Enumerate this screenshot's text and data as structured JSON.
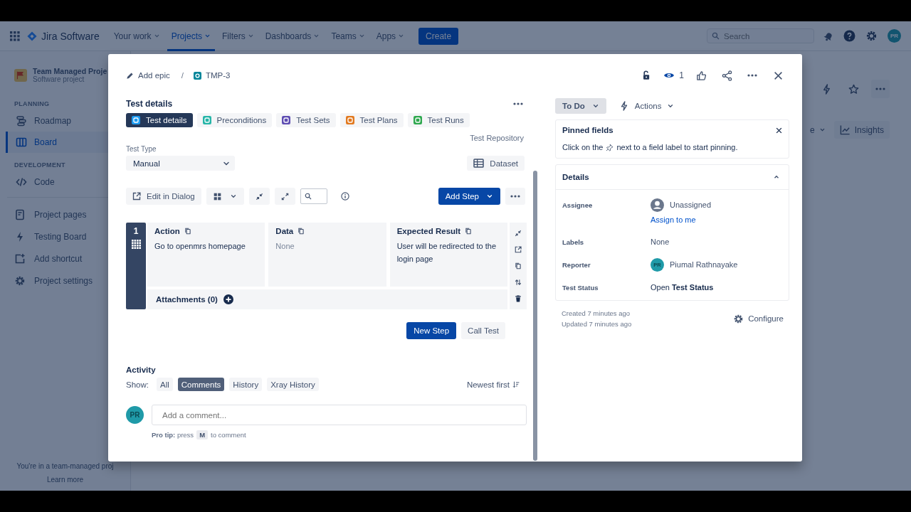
{
  "nav": {
    "product": "Jira Software",
    "items": [
      {
        "label": "Your work",
        "selected": false
      },
      {
        "label": "Projects",
        "selected": true
      },
      {
        "label": "Filters",
        "selected": false
      },
      {
        "label": "Dashboards",
        "selected": false
      },
      {
        "label": "Teams",
        "selected": false
      },
      {
        "label": "Apps",
        "selected": false
      }
    ],
    "create": "Create",
    "search_placeholder": "Search",
    "avatar": "PR"
  },
  "sidebar": {
    "project_name": "Team Managed Proje",
    "project_type": "Software project",
    "sections": [
      {
        "heading": "PLANNING",
        "items": [
          {
            "label": "Roadmap",
            "kind": "roadmap",
            "selected": false
          },
          {
            "label": "Board",
            "kind": "board",
            "selected": true
          }
        ]
      },
      {
        "heading": "DEVELOPMENT",
        "items": [
          {
            "label": "Code",
            "kind": "code",
            "selected": false
          }
        ]
      }
    ],
    "links": [
      {
        "label": "Project pages",
        "kind": "page"
      },
      {
        "label": "Testing Board",
        "kind": "bolt"
      },
      {
        "label": "Add shortcut",
        "kind": "shortcut"
      },
      {
        "label": "Project settings",
        "kind": "gear"
      }
    ],
    "footer": "You're in a team-managed proj",
    "learn_more": "Learn more"
  },
  "board": {
    "filter_fragment": "e",
    "insights": "Insights"
  },
  "issue": {
    "breadcrumb": {
      "parent": "Add epic",
      "separator": "/",
      "key": "TMP-3"
    },
    "watchers": "1",
    "section_title": "Test details",
    "tabs": [
      {
        "label": "Test details",
        "selected": true,
        "color": "#1d9bf0"
      },
      {
        "label": "Preconditions",
        "selected": false,
        "color": "#26b5a8"
      },
      {
        "label": "Test Sets",
        "selected": false,
        "color": "#5e4db2"
      },
      {
        "label": "Test Plans",
        "selected": false,
        "color": "#e2791f"
      },
      {
        "label": "Test Runs",
        "selected": false,
        "color": "#2fa84f"
      }
    ],
    "repository_link": "Test Repository",
    "test_type": {
      "label": "Test Type",
      "value": "Manual"
    },
    "dataset": "Dataset",
    "toolbar": {
      "edit": "Edit in Dialog",
      "add_step": "Add Step"
    },
    "steps": [
      {
        "number": "1",
        "fields": [
          {
            "heading": "Action",
            "value": "Go to openmrs homepage",
            "empty": false
          },
          {
            "heading": "Data",
            "value": "None",
            "empty": true
          },
          {
            "heading": "Expected Result",
            "value": "User will be redirected to the login page",
            "empty": false
          }
        ],
        "attachments": "Attachments (0)"
      }
    ],
    "new_step": "New Step",
    "call_test": "Call Test",
    "activity": {
      "title": "Activity",
      "show_label": "Show:",
      "filters": [
        {
          "label": "All",
          "selected": false
        },
        {
          "label": "Comments",
          "selected": true
        },
        {
          "label": "History",
          "selected": false
        },
        {
          "label": "Xray History",
          "selected": false
        }
      ],
      "sort": "Newest first",
      "avatar": "PR",
      "comment_placeholder": "Add a comment...",
      "pro_tip": "**Pro tip:** press",
      "key": "M",
      "pro_tip_end": "to comment"
    },
    "status": "To Do",
    "actions": "Actions",
    "pinned": {
      "title": "Pinned fields",
      "text_before": "Click on the",
      "text_after": "next to a field label to start pinning."
    },
    "details": {
      "title": "Details",
      "expanded": true,
      "fields": [
        {
          "label": "Assignee",
          "kind": "assignee",
          "value": "Unassigned",
          "link": "Assign to me"
        },
        {
          "label": "Labels",
          "kind": "text",
          "value": "None"
        },
        {
          "label": "Reporter",
          "kind": "user",
          "value": "Piumal Rathnayake",
          "avatar": "PR"
        },
        {
          "label": "Test Status",
          "kind": "rich",
          "value": "Open **Test Status**"
        }
      ]
    },
    "created": "Created 7 minutes ago",
    "updated": "Updated 7 minutes ago",
    "configure": "Configure"
  }
}
